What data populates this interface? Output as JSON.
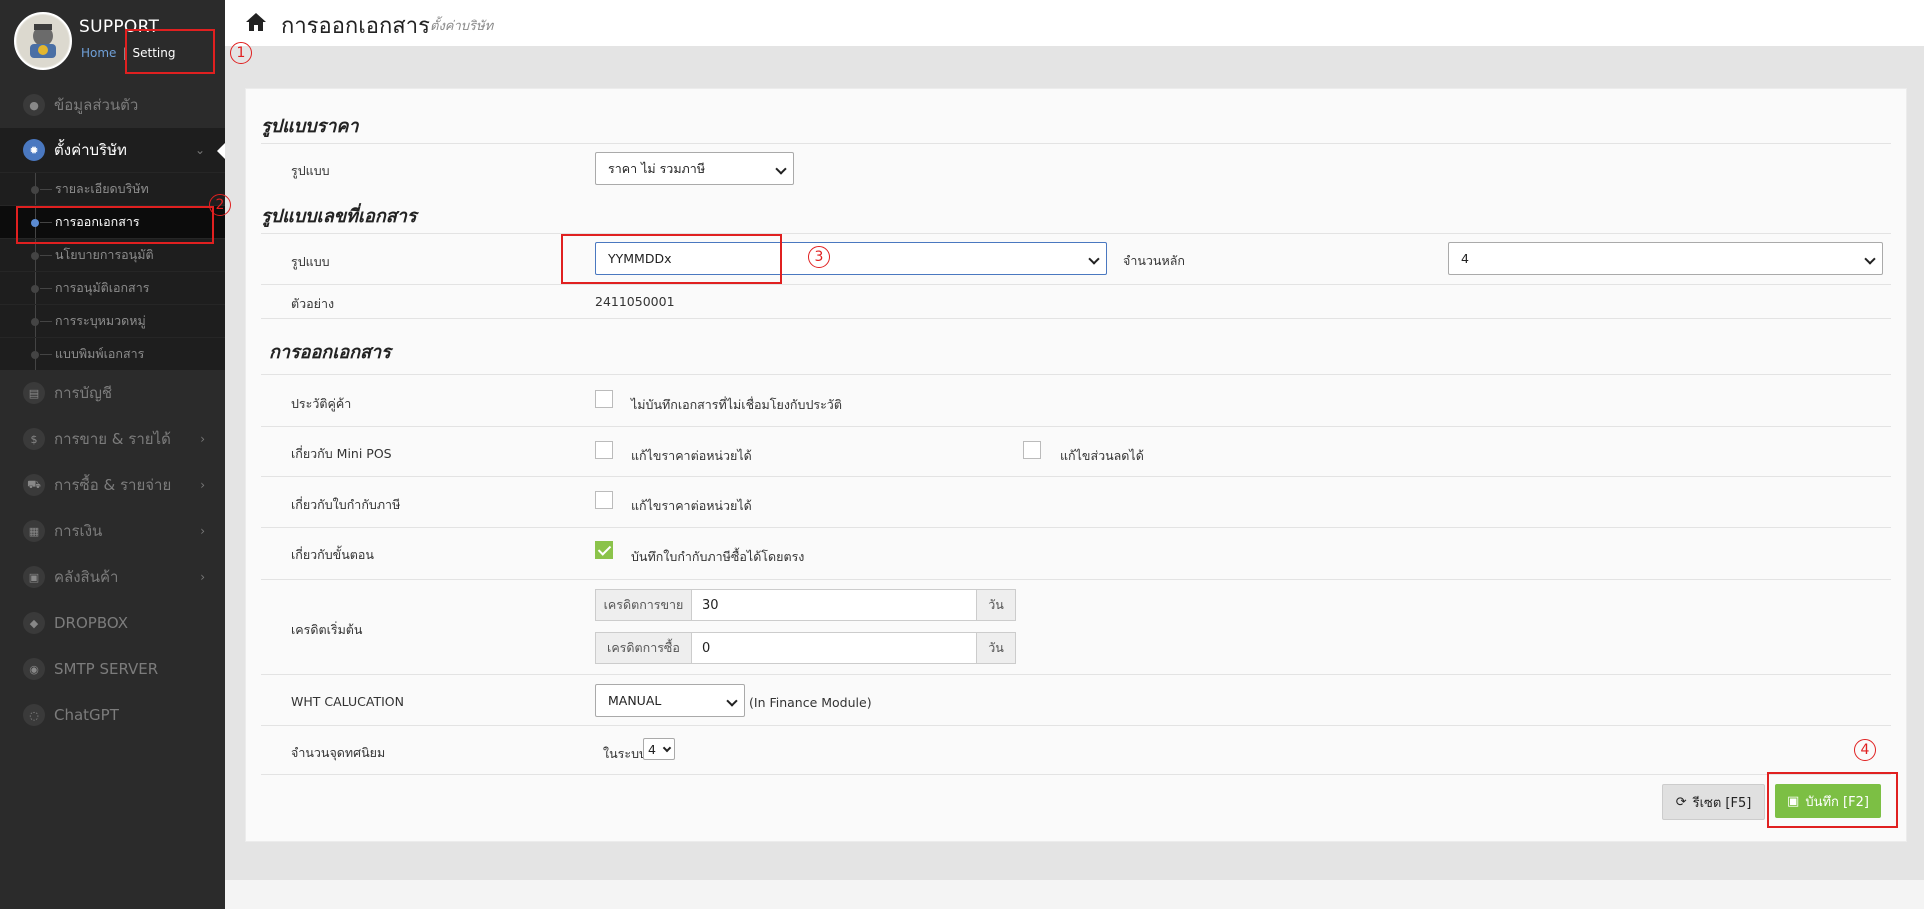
{
  "brand": {
    "title": "SUPPORT",
    "home_link": "Home",
    "setting_link": "Setting"
  },
  "sidebar": {
    "items": [
      {
        "label": "ข้อมูลส่วนตัว",
        "icon": "user-icon"
      },
      {
        "label": "ตั้งค่าบริษัท",
        "icon": "gear-icon"
      },
      {
        "label": "การบัญชี",
        "icon": "book-icon"
      },
      {
        "label": "การขาย & รายได้",
        "icon": "dollar-icon"
      },
      {
        "label": "การซื้อ & รายจ่าย",
        "icon": "cart-icon"
      },
      {
        "label": "การเงิน",
        "icon": "calendar-icon"
      },
      {
        "label": "คลังสินค้า",
        "icon": "box-icon"
      },
      {
        "label": "DROPBOX",
        "icon": "dropbox-icon"
      },
      {
        "label": "SMTP SERVER",
        "icon": "server-icon"
      },
      {
        "label": "ChatGPT",
        "icon": "chat-icon"
      }
    ],
    "subitems": [
      {
        "label": "รายละเอียดบริษัท"
      },
      {
        "label": "การออกเอกสาร"
      },
      {
        "label": "นโยบายการอนุมัติ"
      },
      {
        "label": "การอนุมัติเอกสาร"
      },
      {
        "label": "การระบุหมวดหมู่"
      },
      {
        "label": "แบบพิมพ์เอกสาร"
      }
    ]
  },
  "header": {
    "title": "การออกเอกสาร",
    "subtitle": "ตั้งค่าบริษัท"
  },
  "price_section": {
    "title": "รูปแบบราคา",
    "format_label": "รูปแบบ",
    "format_value": "ราคา ไม่ รวมภาษี"
  },
  "docno_section": {
    "title": "รูปแบบเลขที่เอกสาร",
    "format_label": "รูปแบบ",
    "format_value": "YYMMDDx",
    "digits_label": "จำนวนหลัก",
    "digits_value": "4",
    "example_label": "ตัวอย่าง",
    "example_value": "2411050001"
  },
  "issue_section": {
    "title": "การออกเอกสาร",
    "rows": {
      "customer_history": {
        "label": "ประวัติคู่ค้า",
        "check1": "ไม่บันทึกเอกสารที่ไม่เชื่อมโยงกับประวัติ",
        "check1_on": false
      },
      "mini_pos": {
        "label": "เกี่ยวกับ Mini POS",
        "check1": "แก้ไขราคาต่อหน่วยได้",
        "check2": "แก้ไขส่วนลดได้"
      },
      "tax_invoice": {
        "label": "เกี่ยวกับใบกำกับภาษี",
        "check1": "แก้ไขราคาต่อหน่วยได้"
      },
      "process": {
        "label": "เกี่ยวกับขั้นตอน",
        "check1": "บันทึกใบกำกับภาษีซื้อได้โดยตรง",
        "check1_on": true
      },
      "credit": {
        "label": "เครดิตเริ่มต้น",
        "sale_label": "เครดิตการขาย",
        "sale_value": "30",
        "sale_unit": "วัน",
        "buy_label": "เครดิตการซื้อ",
        "buy_value": "0",
        "buy_unit": "วัน"
      },
      "wht": {
        "label": "WHT CALUCATION",
        "value": "MANUAL",
        "note": "(In Finance Module)"
      },
      "decimal": {
        "label": "จำนวนจุดทศนิยม",
        "prefix": "ในระบบ",
        "value": "4"
      }
    }
  },
  "buttons": {
    "reset": "รีเซต [F5]",
    "save": "บันทึก [F2]"
  },
  "annotations": [
    "1",
    "2",
    "3",
    "4"
  ],
  "colors": {
    "accent": "#e02020",
    "save": "#7cbf44",
    "sidebar": "#2b2b2b",
    "active_icon": "#4a78c0"
  }
}
